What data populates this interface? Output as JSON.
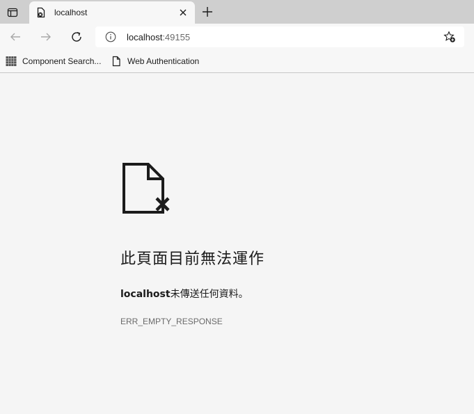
{
  "tab": {
    "title": "localhost",
    "close_icon": "close-icon",
    "favicon": "document-error-icon"
  },
  "toolbar": {
    "back_icon": "back-arrow-icon",
    "forward_icon": "forward-arrow-icon",
    "refresh_icon": "refresh-icon",
    "url_host": "localhost",
    "url_port": ":49155",
    "favorites_icon": "add-favorite-icon"
  },
  "bookmarks": [
    {
      "label": "Component Search...",
      "icon": "grid-icon"
    },
    {
      "label": "Web Authentication",
      "icon": "page-icon"
    }
  ],
  "error": {
    "title": "此頁面目前無法運作",
    "host": "localhost",
    "message": "未傳送任何資料。",
    "code": "ERR_EMPTY_RESPONSE"
  }
}
